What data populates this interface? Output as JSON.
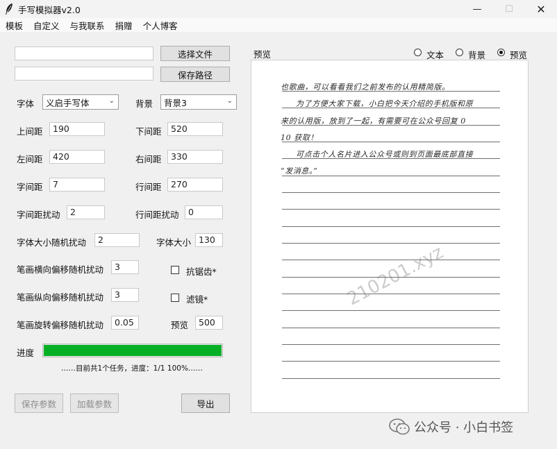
{
  "window": {
    "title": "手写模拟器v2.0",
    "controls": {
      "minimize": "—",
      "maximize": "☐",
      "close": "✕"
    }
  },
  "menu": [
    "模板",
    "自定义",
    "与我联系",
    "捐赠",
    "个人博客"
  ],
  "file": {
    "choose_value": "",
    "choose_button": "选择文件",
    "save_value": "",
    "save_button": "保存路径"
  },
  "font": {
    "label": "字体",
    "value": "义启手写体"
  },
  "background": {
    "label": "背景",
    "value": "背景3"
  },
  "params": {
    "top_margin": {
      "label": "上间距",
      "value": "190"
    },
    "bottom_margin": {
      "label": "下间距",
      "value": "520"
    },
    "left_margin": {
      "label": "左间距",
      "value": "420"
    },
    "right_margin": {
      "label": "右间距",
      "value": "330"
    },
    "char_spacing": {
      "label": "字间距",
      "value": "7"
    },
    "line_spacing": {
      "label": "行间距",
      "value": "270"
    },
    "char_spacing_jitter": {
      "label": "字间距扰动",
      "value": "2"
    },
    "line_spacing_jitter": {
      "label": "行间距扰动",
      "value": "0"
    },
    "font_size_jitter": {
      "label": "字体大小随机扰动",
      "value": "2"
    },
    "font_size": {
      "label": "字体大小",
      "value": "130"
    },
    "stroke_h_jitter": {
      "label": "笔画横向偏移随机扰动",
      "value": "3"
    },
    "stroke_v_jitter": {
      "label": "笔画纵向偏移随机扰动",
      "value": "3"
    },
    "stroke_rot_jitter": {
      "label": "笔画旋转偏移随机扰动",
      "value": "0.05"
    },
    "preview_size": {
      "label": "预览",
      "value": "500"
    }
  },
  "options": {
    "antialias": "抗锯齿*",
    "filter": "滤镜*"
  },
  "progress": {
    "label": "进度",
    "value": 1.0,
    "status": "……目前共1个任务，进度：1/1 100%……"
  },
  "actions": {
    "save_params": "保存参数",
    "load_params": "加载参数",
    "export": "导出"
  },
  "preview": {
    "label": "预览",
    "modes": [
      {
        "label": "文本",
        "selected": false
      },
      {
        "label": "背景",
        "selected": false
      },
      {
        "label": "预览",
        "selected": true
      }
    ],
    "lines": [
      "也歌曲，可以看看我们之前发布的认用精简版。",
      "为了方便大家下载，小白把今天介绍的手机版和原",
      "来的认用版，放到了一起，有需要可在公众号回复 0",
      "10 获取！",
      "可点击个人名片进入公众号或则到页面最底部直接",
      "“发消息。”"
    ],
    "watermark": "210201.xyz"
  },
  "brand": {
    "text": "公众号 · 小白书签"
  },
  "colors": {
    "progress": "#06b025",
    "accent": "#0078d4"
  }
}
